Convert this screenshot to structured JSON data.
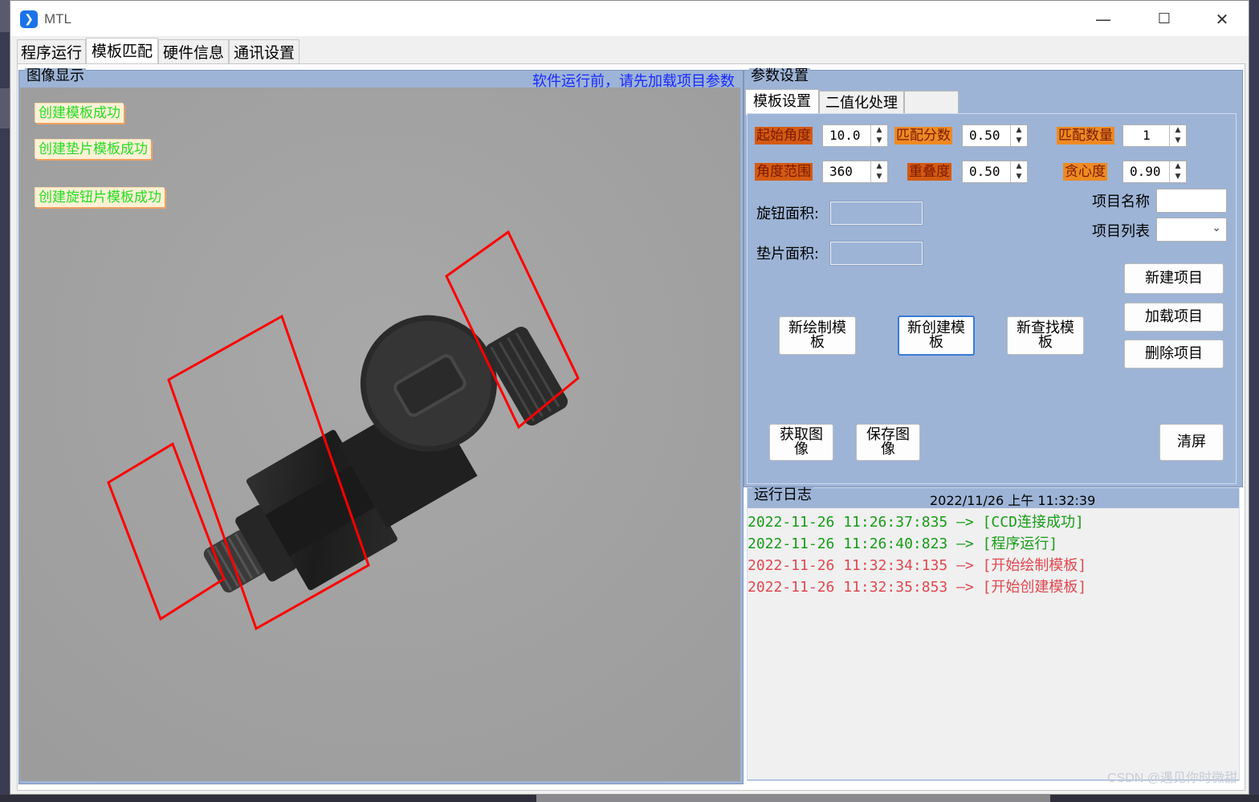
{
  "app": {
    "title": "MTL",
    "icon": "app-logo-icon"
  },
  "window_controls": {
    "minimize": "—",
    "maximize": "☐",
    "close": "✕"
  },
  "tabs": [
    "程序运行",
    "模板匹配",
    "硬件信息",
    "通讯设置"
  ],
  "image_panel": {
    "label": "图像显示",
    "hint": "软件运行前，请先加载项目参数",
    "status_tags": [
      "创建模板成功",
      "创建垫片模板成功",
      "创建旋钮片模板成功"
    ]
  },
  "param_panel": {
    "label": "参数设置",
    "sub_tabs": [
      "模板设置",
      "二值化处理"
    ],
    "fields": {
      "start_angle": {
        "label": "起始角度",
        "value": "10.0"
      },
      "match_score": {
        "label": "匹配分数",
        "value": "0.50"
      },
      "match_count": {
        "label": "匹配数量",
        "value": "1"
      },
      "angle_range": {
        "label": "角度范围",
        "value": "360"
      },
      "overlap": {
        "label": "重叠度",
        "value": "0.50"
      },
      "greediness": {
        "label": "贪心度",
        "value": "0.90"
      }
    },
    "knob_area_label": "旋钮面积:",
    "washer_area_label": "垫片面积:",
    "project_name_label": "项目名称",
    "project_list_label": "项目列表",
    "buttons": {
      "new_project": "新建项目",
      "load_project": "加载项目",
      "delete_project": "删除项目",
      "draw_template": "新绘制模板",
      "create_template": "新创建模板",
      "find_template": "新查找模板",
      "get_image": "获取图像",
      "save_image": "保存图像",
      "clear": "清屏"
    }
  },
  "log_panel": {
    "label": "运行日志",
    "datetime": "2022/11/26 上午 11:32:39",
    "lines": [
      {
        "text": "2022-11-26 11:26:37:835 —> [CCD连接成功]",
        "color": "#169c16"
      },
      {
        "text": "2022-11-26 11:26:40:823 —> [程序运行]",
        "color": "#169c16"
      },
      {
        "text": "2022-11-26 11:32:34:135 —> [开始绘制模板]",
        "color": "#e0484f"
      },
      {
        "text": "2022-11-26 11:32:35:853 —> [开始创建模板]",
        "color": "#e0484f"
      }
    ]
  },
  "watermark": "CSDN @遇见你时微甜",
  "colors": {
    "panel_blue": "#9db4d6",
    "roi_red": "#ff0000",
    "label_orange": "#ee8a22"
  }
}
